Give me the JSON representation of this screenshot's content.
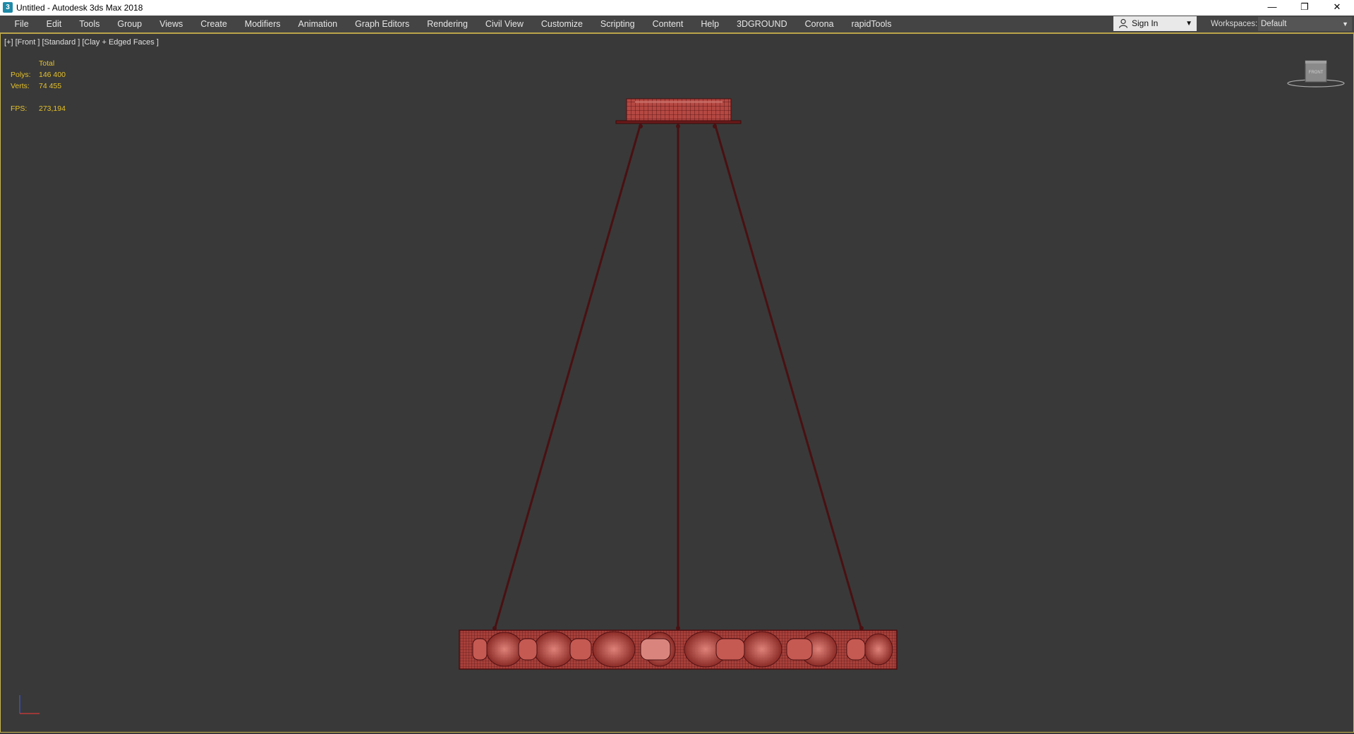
{
  "window": {
    "title": "Untitled - Autodesk 3ds Max 2018",
    "icon_letter": "3",
    "controls": {
      "minimize": "—",
      "restore": "❐",
      "close": "✕"
    }
  },
  "menu": {
    "items": [
      "File",
      "Edit",
      "Tools",
      "Group",
      "Views",
      "Create",
      "Modifiers",
      "Animation",
      "Graph Editors",
      "Rendering",
      "Civil View",
      "Customize",
      "Scripting",
      "Content",
      "Help",
      "3DGROUND",
      "Corona",
      "rapidTools"
    ]
  },
  "account": {
    "sign_in": "Sign In"
  },
  "workspaces": {
    "label": "Workspaces:",
    "value": "Default"
  },
  "viewport": {
    "label": "[+] [Front ] [Standard ] [Clay + Edged Faces ]",
    "stats": {
      "header": "Total",
      "polys_label": "Polys:",
      "polys": "146 400",
      "verts_label": "Verts:",
      "verts": "74 455",
      "fps_label": "FPS:",
      "fps": "273,194"
    },
    "viewcube_face": "FRONT"
  },
  "colors": {
    "background": "#393939",
    "menubar": "#444444",
    "viewport_border": "#c8b64e",
    "stats_text": "#e6c229",
    "model_fill": "#b8473f",
    "model_wire": "#4a0e10"
  }
}
